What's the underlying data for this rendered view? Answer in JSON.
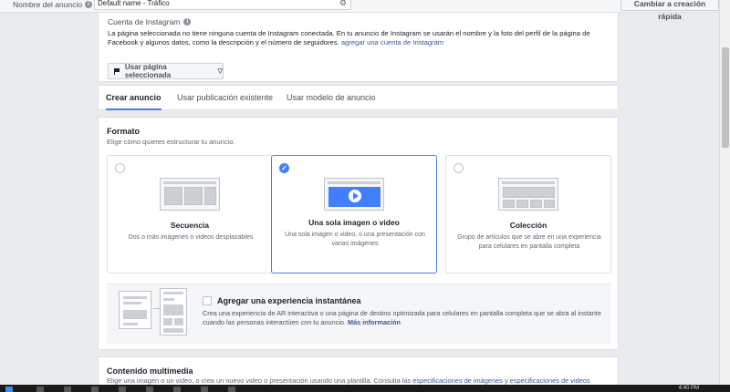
{
  "topbar": {
    "ad_name_label": "Nombre del anuncio",
    "ad_name_value": "Default name - Tráfico",
    "quick_create_label": "Cambiar a creación rápida"
  },
  "instagram": {
    "title": "Cuenta de Instagram",
    "description": "La página seleccionada no tiene ninguna cuenta de Instagram conectada. En tu anuncio de Instagram se usarán el nombre y la foto del perfil de la página de Facebook y algunos datos, como la descripción y el número de seguidores.",
    "link_label": "agregar una cuenta de Instagram",
    "page_select_label": "Usar página seleccionada"
  },
  "tabs": [
    {
      "label": "Crear anuncio",
      "active": true
    },
    {
      "label": "Usar publicación existente",
      "active": false
    },
    {
      "label": "Usar modelo de anuncio",
      "active": false
    }
  ],
  "format": {
    "title": "Formato",
    "subtitle": "Elige cómo quieres estructurar tu anuncio.",
    "cards": [
      {
        "title": "Secuencia",
        "description": "Dos o más imágenes o videos desplazables",
        "selected": false
      },
      {
        "title": "Una sola imagen o video",
        "description": "Una sola imagen o video, o una presentación con varias imágenes",
        "selected": true
      },
      {
        "title": "Colección",
        "description": "Grupo de artículos que se abre en una experiencia para celulares en pantalla completa",
        "selected": false
      }
    ]
  },
  "instant_experience": {
    "title": "Agregar una experiencia instantánea",
    "description": "Crea una experiencia de AR interactiva o una página de destino optimizada para celulares en pantalla completa que se abra al instante cuando las personas interactúen con tu anuncio.",
    "link_label": "Más información"
  },
  "media": {
    "title": "Contenido multimedia",
    "description": "Elige una imagen o un video, o crea un nuevo video o presentación usando una plantilla. Consulta las",
    "link1": "especificaciones de imágenes",
    "joiner": "y",
    "link2": "especificaciones de videos"
  },
  "taskbar": {
    "time": "4:40 PM"
  },
  "icons": {
    "info": "info-icon",
    "gear": "gear-icon",
    "flag": "flag-icon",
    "caret": "chevron-down-icon",
    "check": "check-icon"
  },
  "colors": {
    "accent": "#4080ff",
    "link": "#365899",
    "background": "#e9ebee"
  }
}
